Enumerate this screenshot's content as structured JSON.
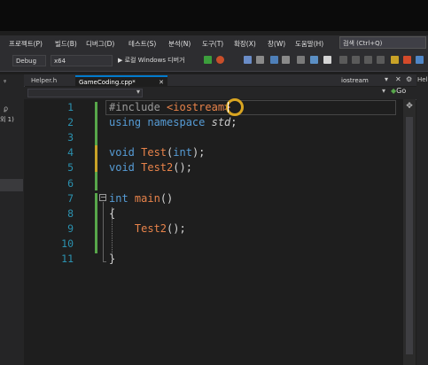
{
  "menu": {
    "items": [
      "프로젝트(P)",
      "빌드(B)",
      "디버그(D)",
      "테스트(S)",
      "분석(N)",
      "도구(T)",
      "확장(X)",
      "창(W)",
      "도움말(H)"
    ],
    "search_placeholder": "검색 (Ctrl+Q)"
  },
  "toolbar": {
    "config": "Debug",
    "platform": "x64",
    "run_label": "▶ 로컬 Windows 디버거"
  },
  "left_panel": {
    "pin_glyph": "ᵠ",
    "side_text": "외 1)",
    "search_glyph": "ϼ"
  },
  "tabs": {
    "helper": "Helper.h",
    "active": "GameCoding.cpp*",
    "right": "iostream",
    "go": "Go",
    "help_strip": "Help"
  },
  "editor": {
    "line_numbers": [
      "1",
      "2",
      "3",
      "4",
      "5",
      "6",
      "7",
      "8",
      "9",
      "10",
      "11"
    ],
    "lines": [
      [
        {
          "t": "#include ",
          "c": "#9b9b9b"
        },
        {
          "t": "<iostream>",
          "c": "#e8834a"
        }
      ],
      [
        {
          "t": "using namespace ",
          "c": "#569cd6"
        },
        {
          "t": "std",
          "c": "#c8c8c8",
          "i": true
        },
        {
          "t": ";",
          "c": "#d4d4d4"
        }
      ],
      [],
      [
        {
          "t": "void ",
          "c": "#569cd6"
        },
        {
          "t": "Test",
          "c": "#e8834a"
        },
        {
          "t": "(",
          "c": "#d4d4d4"
        },
        {
          "t": "int",
          "c": "#569cd6"
        },
        {
          "t": ");",
          "c": "#d4d4d4"
        }
      ],
      [
        {
          "t": "void ",
          "c": "#569cd6"
        },
        {
          "t": "Test2",
          "c": "#e8834a"
        },
        {
          "t": "();",
          "c": "#d4d4d4"
        }
      ],
      [],
      [
        {
          "t": "int ",
          "c": "#569cd6"
        },
        {
          "t": "main",
          "c": "#e8834a"
        },
        {
          "t": "()",
          "c": "#d4d4d4"
        }
      ],
      [
        {
          "t": "{",
          "c": "#d4d4d4"
        }
      ],
      [
        {
          "t": "    Test2",
          "c": "#e8834a"
        },
        {
          "t": "();",
          "c": "#d4d4d4"
        }
      ],
      [],
      [
        {
          "t": "}",
          "c": "#d4d4d4"
        }
      ]
    ]
  },
  "colors": {
    "accent_green": "#57a64a",
    "line_number": "#2b91af",
    "cursor_ring": "#d9a521",
    "keyword": "#569cd6",
    "identifier": "#e8834a"
  }
}
